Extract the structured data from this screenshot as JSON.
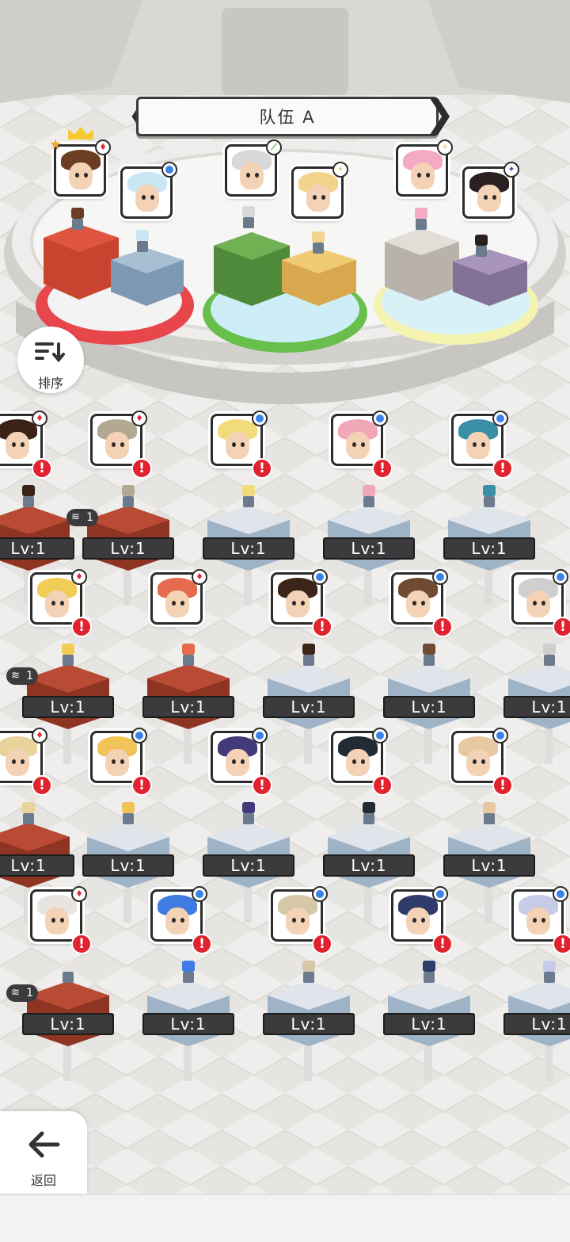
{
  "team": {
    "title": "队伍 A",
    "prev_arrow": "❮",
    "next_arrow": "❯"
  },
  "sort_button": {
    "label": "排序"
  },
  "back_button": {
    "label": "返回",
    "arrow": "←"
  },
  "colors": {
    "alert": "#e0232f",
    "badge_blue": "#3a82e8",
    "badge_red": "#e22a3c",
    "level_bg": "#3b3b3d"
  },
  "team_slots": [
    {
      "hair": "#6b3d22",
      "badge": "red",
      "badge_text": "♦",
      "leader": true
    },
    {
      "hair": "#c9e7f3",
      "badge": "blue",
      "badge_text": ""
    },
    {
      "hair": "#d8d8d8",
      "badge": "green",
      "badge_text": "⟋"
    },
    {
      "hair": "#f4d38c",
      "badge": "yellow",
      "badge_text": "⚡"
    },
    {
      "hair": "#f4a9c4",
      "badge": "star",
      "badge_text": "✧"
    },
    {
      "hair": "#2a2020",
      "badge": "purple",
      "badge_text": "✦"
    }
  ],
  "leader_star": "★",
  "roster": [
    {
      "row": 0,
      "col": 0,
      "level": "Lv:1",
      "hair": "#3a2316",
      "badge": "red",
      "alert": true,
      "stack": ""
    },
    {
      "row": 0,
      "col": 1,
      "level": "Lv:1",
      "hair": "#b3a894",
      "badge": "red",
      "alert": true,
      "stack": "1"
    },
    {
      "row": 0,
      "col": 2,
      "level": "Lv:1",
      "hair": "#f1db7a",
      "badge": "blue",
      "alert": true,
      "stack": ""
    },
    {
      "row": 0,
      "col": 3,
      "level": "Lv:1",
      "hair": "#f0a8b8",
      "badge": "blue",
      "alert": true,
      "stack": ""
    },
    {
      "row": 0,
      "col": 4,
      "level": "Lv:1",
      "hair": "#3a8fa6",
      "badge": "blue",
      "alert": true,
      "stack": ""
    },
    {
      "row": 1,
      "col": 0,
      "level": "Lv:1",
      "hair": "#f1cd57",
      "badge": "red",
      "alert": true,
      "stack": "1"
    },
    {
      "row": 1,
      "col": 1,
      "level": "Lv:1",
      "hair": "#e56a4e",
      "badge": "red",
      "alert": false,
      "stack": ""
    },
    {
      "row": 1,
      "col": 2,
      "level": "Lv:1",
      "hair": "#3b2418",
      "badge": "blue",
      "alert": true,
      "stack": ""
    },
    {
      "row": 1,
      "col": 3,
      "level": "Lv:1",
      "hair": "#6f4b33",
      "badge": "blue",
      "alert": true,
      "stack": ""
    },
    {
      "row": 1,
      "col": 4,
      "level": "Lv:1",
      "hair": "#cfcfcf",
      "badge": "blue",
      "alert": true,
      "stack": ""
    },
    {
      "row": 2,
      "col": 0,
      "level": "Lv:1",
      "hair": "#e6d49a",
      "badge": "red",
      "alert": true,
      "stack": ""
    },
    {
      "row": 2,
      "col": 1,
      "level": "Lv:1",
      "hair": "#f2c357",
      "badge": "blue",
      "alert": true,
      "stack": ""
    },
    {
      "row": 2,
      "col": 2,
      "level": "Lv:1",
      "hair": "#433a7a",
      "badge": "blue",
      "alert": true,
      "stack": ""
    },
    {
      "row": 2,
      "col": 3,
      "level": "Lv:1",
      "hair": "#222a34",
      "badge": "blue",
      "alert": true,
      "stack": ""
    },
    {
      "row": 2,
      "col": 4,
      "level": "Lv:1",
      "hair": "#e8c8a0",
      "badge": "blue",
      "alert": true,
      "stack": ""
    },
    {
      "row": 3,
      "col": 0,
      "level": "Lv:1",
      "hair": "#e8e4df",
      "badge": "red",
      "alert": true,
      "stack": "1"
    },
    {
      "row": 3,
      "col": 1,
      "level": "Lv:1",
      "hair": "#3f7be0",
      "badge": "blue",
      "alert": true,
      "stack": ""
    },
    {
      "row": 3,
      "col": 2,
      "level": "Lv:1",
      "hair": "#d6c7a8",
      "badge": "blue",
      "alert": true,
      "stack": ""
    },
    {
      "row": 3,
      "col": 3,
      "level": "Lv:1",
      "hair": "#2f3b6a",
      "badge": "blue",
      "alert": true,
      "stack": ""
    },
    {
      "row": 3,
      "col": 4,
      "level": "Lv:1",
      "hair": "#c8cbe8",
      "badge": "blue",
      "alert": true,
      "stack": ""
    }
  ],
  "alert_symbol": "!"
}
